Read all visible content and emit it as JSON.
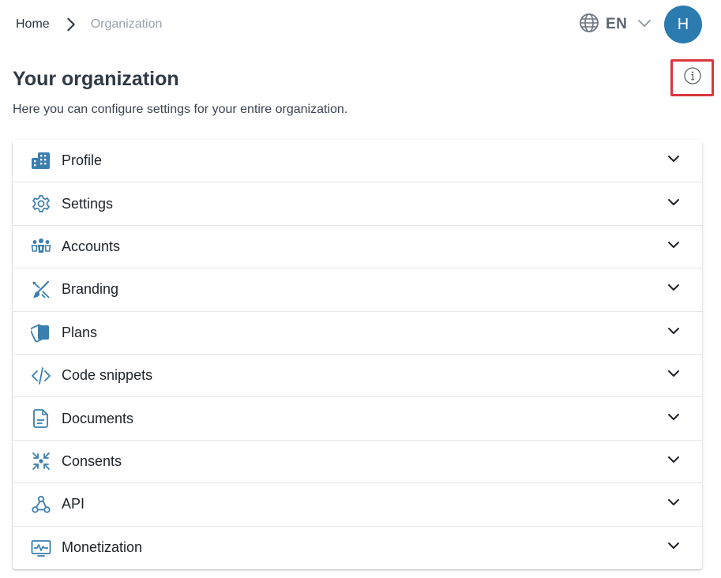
{
  "breadcrumb": {
    "home": "Home",
    "current": "Organization"
  },
  "language": {
    "code": "EN"
  },
  "user": {
    "initial": "H"
  },
  "page": {
    "title": "Your organization",
    "description": "Here you can configure settings for your entire organization."
  },
  "sections": [
    {
      "label": "Profile",
      "icon": "building-icon"
    },
    {
      "label": "Settings",
      "icon": "gear-icon"
    },
    {
      "label": "Accounts",
      "icon": "users-icon"
    },
    {
      "label": "Branding",
      "icon": "brush-icon"
    },
    {
      "label": "Plans",
      "icon": "cards-icon"
    },
    {
      "label": "Code snippets",
      "icon": "code-icon"
    },
    {
      "label": "Documents",
      "icon": "document-icon"
    },
    {
      "label": "Consents",
      "icon": "consent-icon"
    },
    {
      "label": "API",
      "icon": "webhook-icon"
    },
    {
      "label": "Monetization",
      "icon": "monitor-chart-icon"
    }
  ],
  "colors": {
    "accent": "#2b7bb0",
    "highlight": "#d9373d"
  }
}
